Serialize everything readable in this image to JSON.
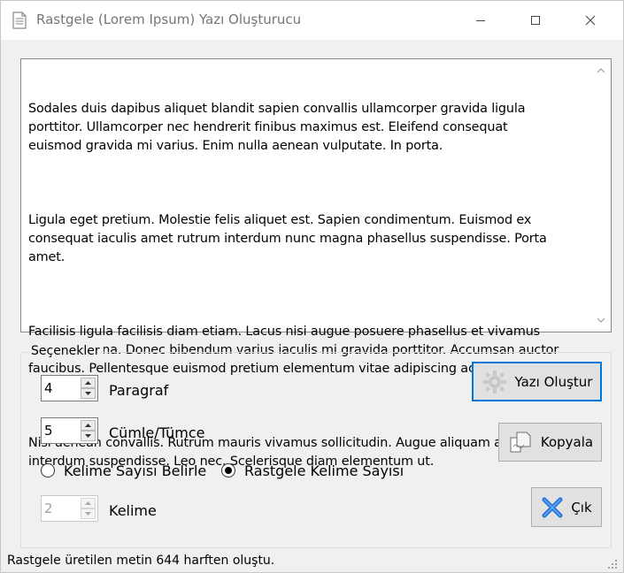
{
  "window": {
    "title": "Rastgele (Lorem Ipsum) Yazı Oluşturucu"
  },
  "output": {
    "paragraphs": [
      "Sodales duis dapibus aliquet blandit sapien convallis ullamcorper gravida ligula\nporttitor. Ullamcorper nec hendrerit finibus maximus est. Eleifend consequat\neuismod gravida mi varius. Enim nulla aenean vulputate. In porta.",
      "Ligula eget pretium. Molestie felis aliquet est. Sapien condimentum. Euismod ex\nconsequat iaculis amet rutrum interdum nunc magna phasellus suspendisse. Porta\namet.",
      "Facilisis ligula facilisis diam etiam. Lacus nisi augue posuere phasellus et vivamus\ninterdum urna. Donec bibendum varius iaculis mi gravida porttitor. Accumsan auctor\nfaucibus. Pellentesque euismod pretium elementum vitae adipiscing ac.",
      "Nisi aenean convallis. Rutrum mauris vivamus sollicitudin. Augue aliquam a\ninterdum suspendisse. Leo nec. Scelerisque diam elementum ut."
    ]
  },
  "options": {
    "group_label": "Seçenekler",
    "paragraph": {
      "value": "4",
      "label": "Paragraf"
    },
    "sentence": {
      "value": "5",
      "label": "Cümle/Tümce"
    },
    "radio_fixed": {
      "label": "Kelime Sayısı Belirle",
      "checked": false
    },
    "radio_random": {
      "label": "Rastgele Kelime Sayısı",
      "checked": true
    },
    "word": {
      "value": "2",
      "label": "Kelime",
      "disabled": true
    }
  },
  "buttons": {
    "generate": "Yazı Oluştur",
    "copy": "Kopyala",
    "exit": "Çık"
  },
  "status": {
    "text": "Rastgele üretilen metin 644 harften oluştu."
  },
  "colors": {
    "accent": "#0078d7",
    "exit_icon": "#1e6fd9"
  }
}
